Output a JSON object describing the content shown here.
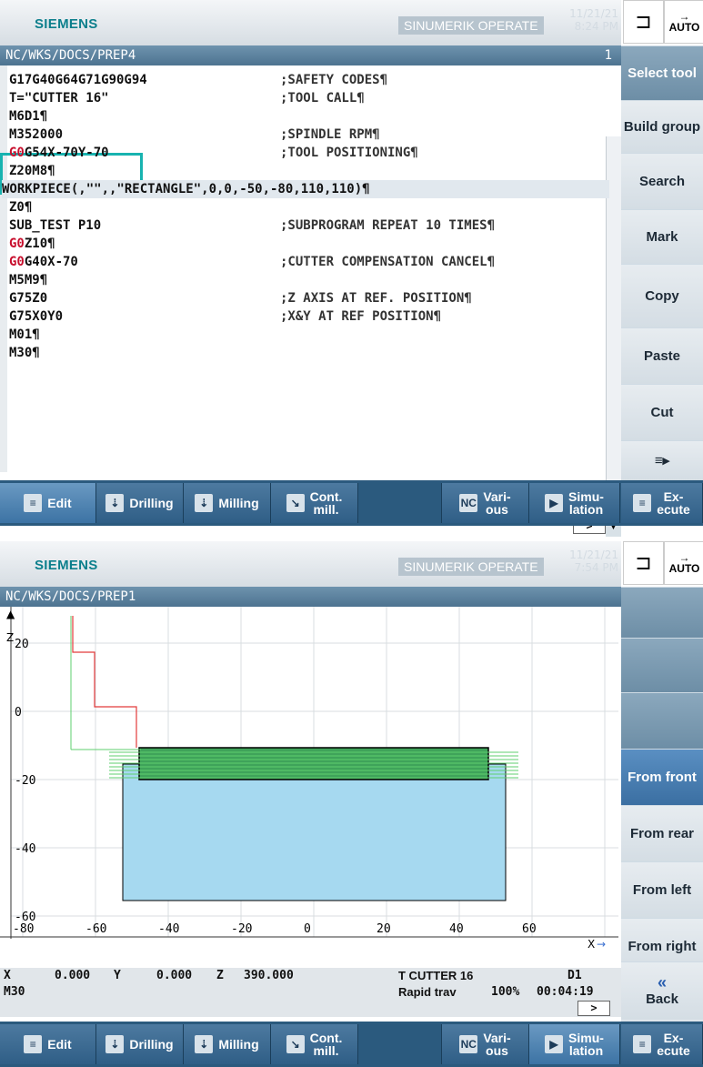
{
  "brand": "SIEMENS",
  "product": "SINUMERIK OPERATE",
  "mode": "AUTO",
  "editor_screen": {
    "date": "11/21/21",
    "time": "8:24 PM",
    "path": "NC/WKS/DOCS/PREP4",
    "line_number": "1",
    "lines": [
      {
        "code": "G17G40G64G71G90G94",
        "comment": ";SAFETY CODES¶"
      },
      {
        "code": "T=\"CUTTER 16\"",
        "comment": ";TOOL CALL¶"
      },
      {
        "code": "M6D1¶",
        "comment": ""
      },
      {
        "code": "M352000",
        "comment": ";SPINDLE RPM¶"
      },
      {
        "code": "G0G54X-70Y-70",
        "comment": ";TOOL POSITIONING¶"
      },
      {
        "code": "Z20M8¶",
        "comment": ""
      },
      {
        "code": "WORKPIECE(,\"\",,\"RECTANGLE\",0,0,-50,-80,110,110)¶",
        "comment": ""
      },
      {
        "code": "Z0¶",
        "comment": ""
      },
      {
        "code": "SUB_TEST P10",
        "comment": ";SUBPROGRAM REPEAT 10 TIMES¶"
      },
      {
        "code": "G0Z10¶",
        "comment": ""
      },
      {
        "code": "G0G40X-70",
        "comment": ";CUTTER COMPENSATION CANCEL¶"
      },
      {
        "code": "M5M9¶",
        "comment": ""
      },
      {
        "code": "G75Z0",
        "comment": ";Z AXIS AT REF. POSITION¶"
      },
      {
        "code": "G75X0Y0",
        "comment": ";X&Y AT REF POSITION¶"
      },
      {
        "code": "M01¶",
        "comment": ""
      },
      {
        "code": "M30¶",
        "comment": ""
      }
    ],
    "vertical_softkeys": [
      "Select tool",
      "Build group",
      "Search",
      "Mark",
      "Copy",
      "Paste",
      "Cut",
      ""
    ],
    "horizontal_softkeys": {
      "edit": "Edit",
      "drilling": "Drilling",
      "milling": "Milling",
      "cont_mill_1": "Cont.",
      "cont_mill_2": "mill.",
      "various_1": "Vari-",
      "various_2": "ous",
      "simulation_1": "Simu-",
      "simulation_2": "lation",
      "execute_1": "Ex-",
      "execute_2": "ecute"
    }
  },
  "simulation_screen": {
    "date": "11/21/21",
    "time": "7:54 PM",
    "path": "NC/WKS/DOCS/PREP1",
    "axis_labels": {
      "z": "Z",
      "x": "X"
    },
    "x_ticks": [
      "-80",
      "-60",
      "-40",
      "-20",
      "0",
      "20",
      "40",
      "60"
    ],
    "z_ticks": [
      "20",
      "0",
      "-20",
      "-40",
      "-60"
    ],
    "status": {
      "x_label": "X",
      "x_value": "0.000",
      "y_label": "Y",
      "y_value": "0.000",
      "z_label": "Z",
      "z_value": "390.000",
      "tool": "T CUTTER 16",
      "d": "D1",
      "block": "M30",
      "feed_mode": "Rapid trav",
      "override": "100%",
      "elapsed": "00:04:19"
    },
    "vertical_softkeys": [
      "",
      "",
      "",
      "From front",
      "From rear",
      "From left",
      "From right",
      "",
      "Back"
    ],
    "back_symbol": "«",
    "horizontal_softkeys": {
      "edit": "Edit",
      "drilling": "Drilling",
      "milling": "Milling",
      "cont_mill_1": "Cont.",
      "cont_mill_2": "mill.",
      "various_1": "Vari-",
      "various_2": "ous",
      "simulation_1": "Simu-",
      "simulation_2": "lation",
      "execute_1": "Ex-",
      "execute_2": "ecute"
    }
  }
}
